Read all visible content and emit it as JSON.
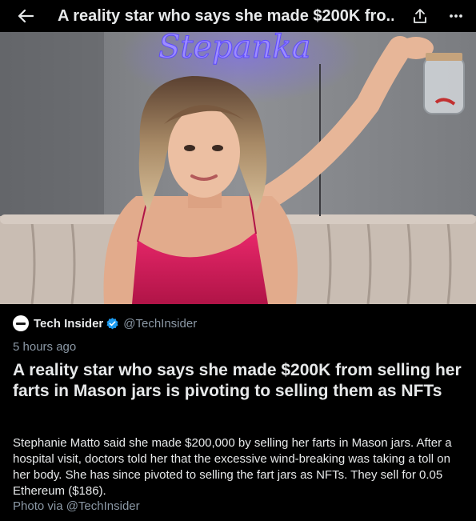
{
  "header": {
    "title": "A reality star who says she made $200K fro...",
    "back_icon": "back-arrow-icon",
    "share_icon": "share-icon",
    "more_icon": "more-icon"
  },
  "photo": {
    "neon_sign_text": "Stepanka"
  },
  "article": {
    "author_name": "Tech Insider",
    "author_handle": "@TechInsider",
    "verified_icon": "verified-badge-icon",
    "timestamp": "5 hours ago",
    "headline": "A reality star who says she made $200K from selling her farts in Mason jars is pivoting to selling them as NFTs",
    "body": "Stephanie Matto said she made $200,000 by selling her farts in Mason jars. After a hospital visit, doctors told her that the excessive wind-breaking was taking a toll on her body. She has since pivoted to selling the fart jars as NFTs. They sell for 0.05 Ethereum ($186).",
    "photo_credit": "Photo via @TechInsider"
  },
  "colors": {
    "background": "#000000",
    "text_primary": "#e7e9ea",
    "text_secondary": "#8b98a5",
    "verified_blue": "#1d9bf0",
    "neon_purple": "#6f5cff",
    "dress_pink": "#d81c5a"
  }
}
